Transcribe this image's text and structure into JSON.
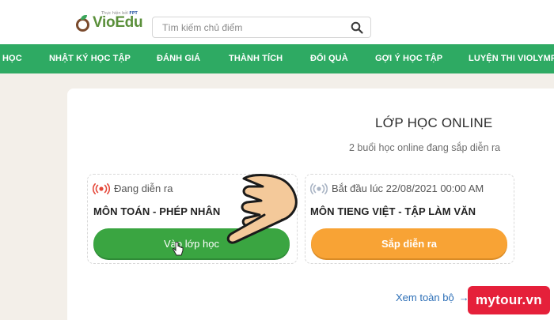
{
  "header": {
    "logo_text": "VioEdu",
    "logo_badge_prefix": "Thực hiện bởi",
    "logo_badge_brand": "FPT",
    "search": {
      "placeholder": "Tìm kiếm chủ điểm",
      "value": ""
    }
  },
  "nav": {
    "items": [
      {
        "label": "HỌC"
      },
      {
        "label": "NHẬT KÝ HỌC TẬP"
      },
      {
        "label": "ĐÁNH GIÁ"
      },
      {
        "label": "THÀNH TÍCH"
      },
      {
        "label": "ĐỔI QUÀ"
      },
      {
        "label": "GỢI Ý HỌC TẬP"
      },
      {
        "label": "LUYỆN THI VIOLYMP"
      }
    ]
  },
  "online": {
    "title": "LỚP HỌC ONLINE",
    "subtitle": "2 buổi học online đang sắp diễn ra",
    "classes": [
      {
        "status": "Đang diễn ra",
        "status_icon": "live-broadcast-icon",
        "status_color": "#e5483a",
        "name": "MÔN TOÁN - PHÉP NHÂN",
        "button": "Vào lớp học",
        "button_color": "#3aa541"
      },
      {
        "status": "Bắt đầu lúc 22/08/2021 00:00 AM",
        "status_icon": "broadcast-icon",
        "status_color": "#a9b4c4",
        "name": "MÔN TIENG VIỆT - TẬP LÀM VĂN",
        "button": "Sắp diễn ra",
        "button_color": "#f8a335"
      }
    ],
    "see_all": "Xem toàn bộ"
  },
  "watermark": {
    "text": "mytour.vn",
    "color": "#e5203a"
  },
  "colors": {
    "nav": "#2eaa63",
    "background": "#f3efe9",
    "accent": "#2eaa63"
  }
}
